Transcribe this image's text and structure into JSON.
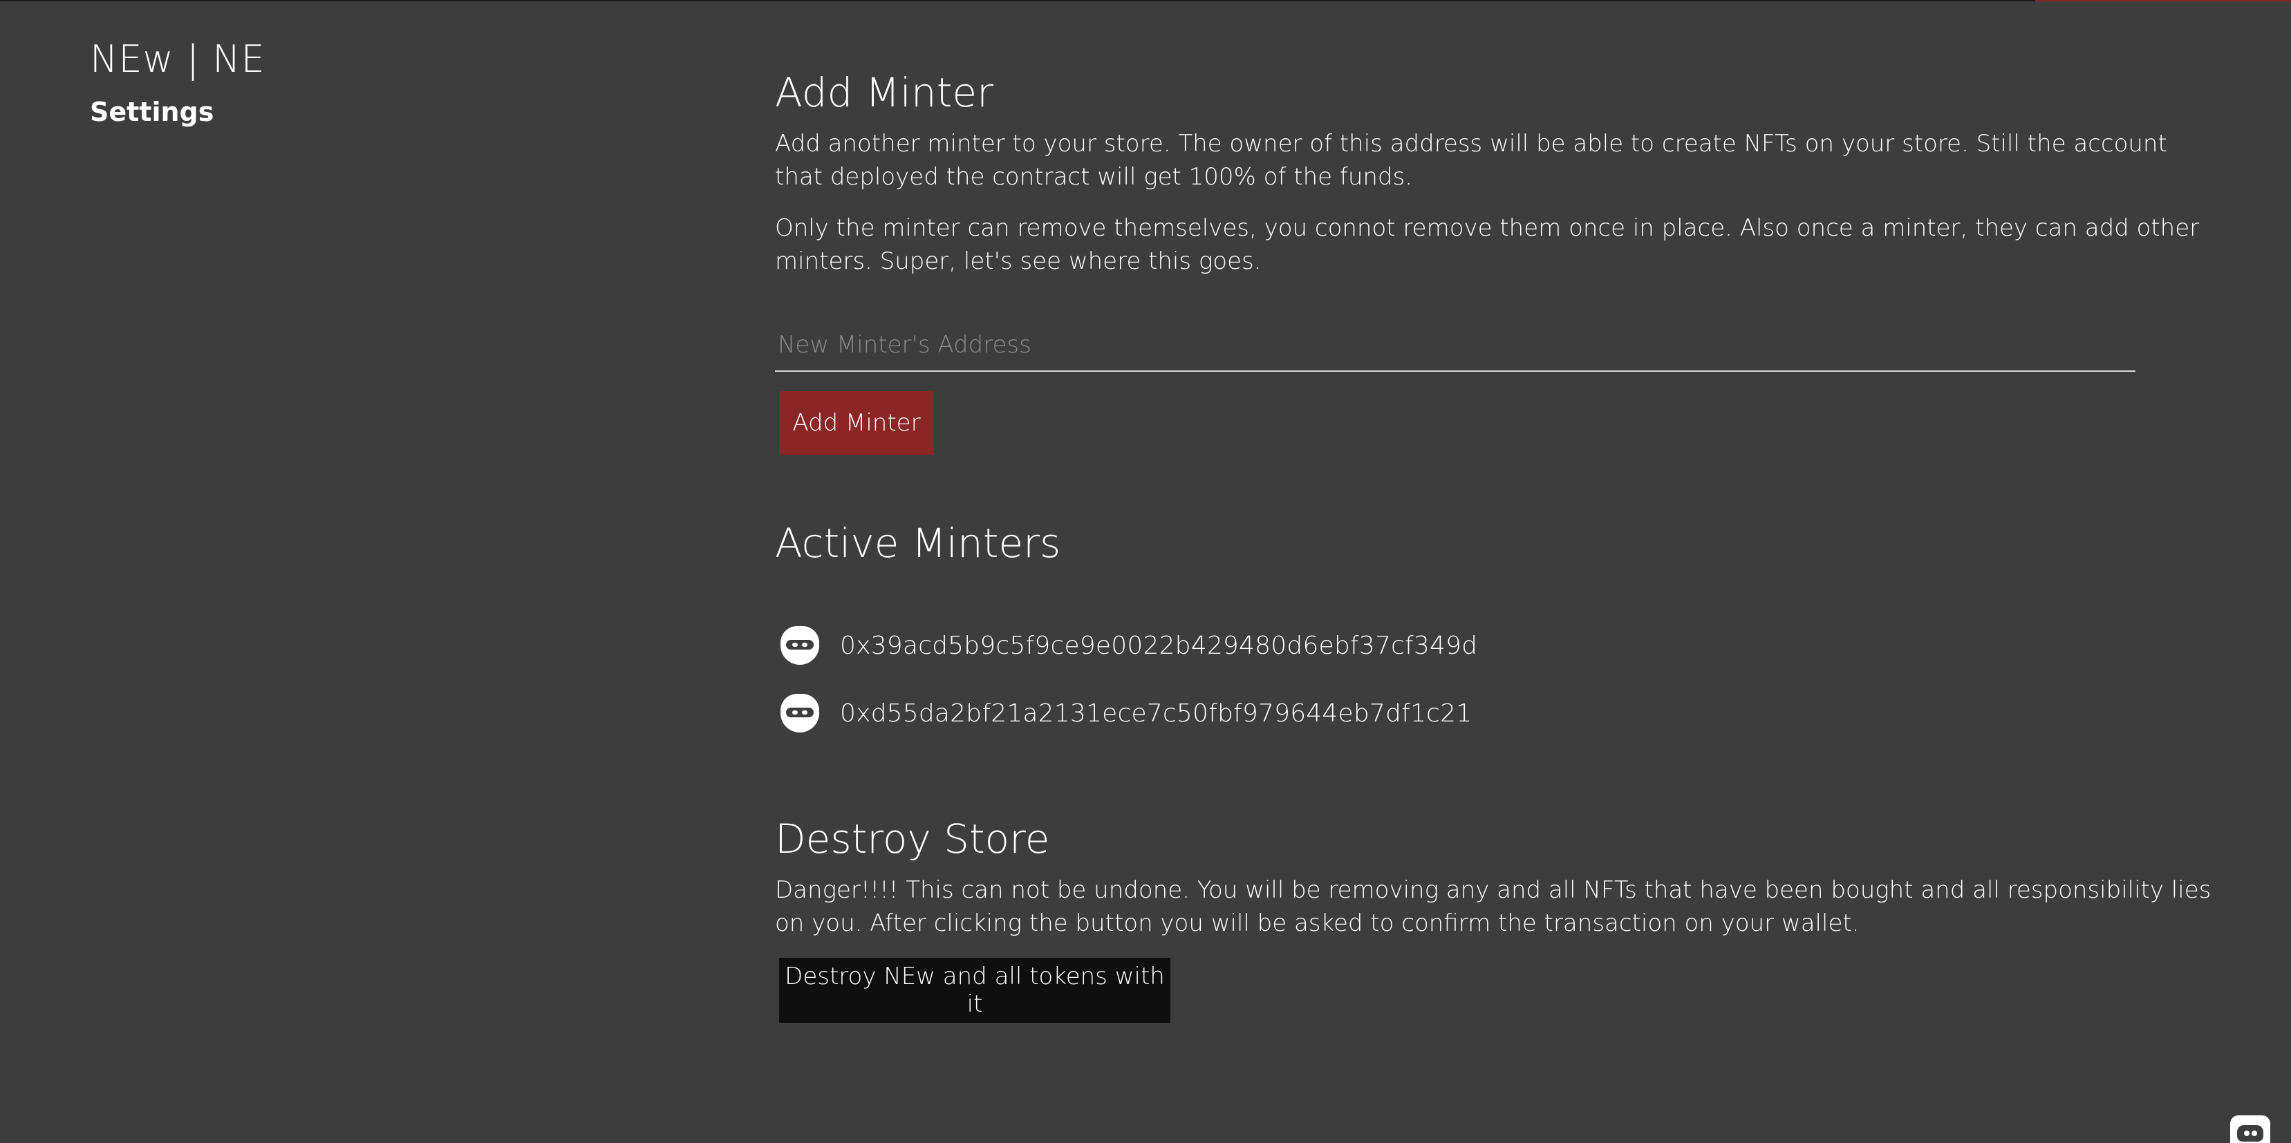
{
  "header": {
    "brand": "NEw | NE",
    "subtitle": "Settings"
  },
  "add_minter": {
    "title": "Add Minter",
    "description_1": "Add another minter to your store. The owner of this address will be able to create NFTs on your store. Still the account that deployed the contract will get 100% of the funds.",
    "description_2": "Only the minter can remove themselves, you connot remove them once in place. Also once a minter, they can add other minters. Super, let's see where this goes.",
    "input_placeholder": "New Minter's Address",
    "button_label": "Add Minter",
    "accent_color": "#8b2626"
  },
  "active_minters": {
    "title": "Active Minters",
    "items": [
      {
        "address": "0x39acd5b9c5f9ce9e0022b429480d6ebf37cf349d",
        "icon": "user-avatar-icon"
      },
      {
        "address": "0xd55da2bf21a2131ece7c50fbf979644eb7df1c21",
        "icon": "user-avatar-icon"
      }
    ]
  },
  "destroy_store": {
    "title": "Destroy Store",
    "description": "Danger!!!! This can not be undone. You will be removing any and all NFTs that have been bought and all responsibility lies on you. After clicking the button you will be asked to confirm the transaction on your wallet.",
    "button_label": "Destroy NEw and all tokens with it"
  },
  "footer": {
    "icon": "discord-icon"
  }
}
